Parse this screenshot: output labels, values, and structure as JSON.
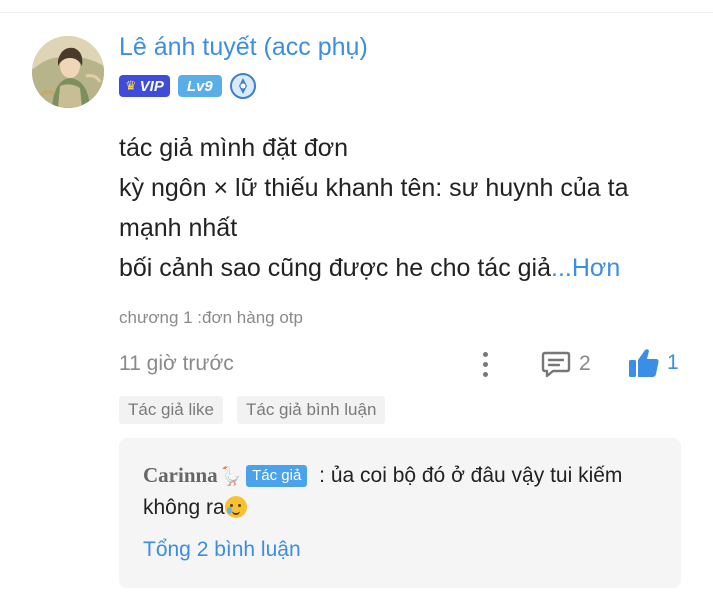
{
  "user": {
    "name": "Lê ánh tuyết (acc phụ)",
    "avatar_icon": "user-avatar-illustration",
    "badges": {
      "vip_label": "VIP",
      "vip_icon": "crown-icon",
      "level_label": "Lv9",
      "medal_icon": "blue-medal-icon"
    }
  },
  "comment": {
    "lines": [
      "tác giả mình đặt đơn",
      "kỳ ngôn × lữ thiếu khanh tên: sư huynh của ta",
      "mạnh nhất",
      "bối cảnh sao cũng được he cho tác giả"
    ],
    "more_label": "...Hơn",
    "chapter": "chương 1 :đơn hàng otp",
    "time": "11 giờ trước",
    "reply_count": "2",
    "like_count": "1"
  },
  "tags": [
    "Tác giả like",
    "Tác giả bình luận"
  ],
  "reply": {
    "author": "Carinna",
    "author_badge": "Tác giả",
    "text": " : ủa coi bộ đó ở đâu vậy tui kiếm không ra",
    "emoji_icon": "crying-face-emoji",
    "total_label": "Tổng 2 bình luận"
  },
  "colors": {
    "accent": "#3a8ee6",
    "vip_bg": "#3f4cd9",
    "level_bg": "#5aaee8",
    "muted_text": "#8a8a8a",
    "reply_bg": "#f5f5f5"
  }
}
